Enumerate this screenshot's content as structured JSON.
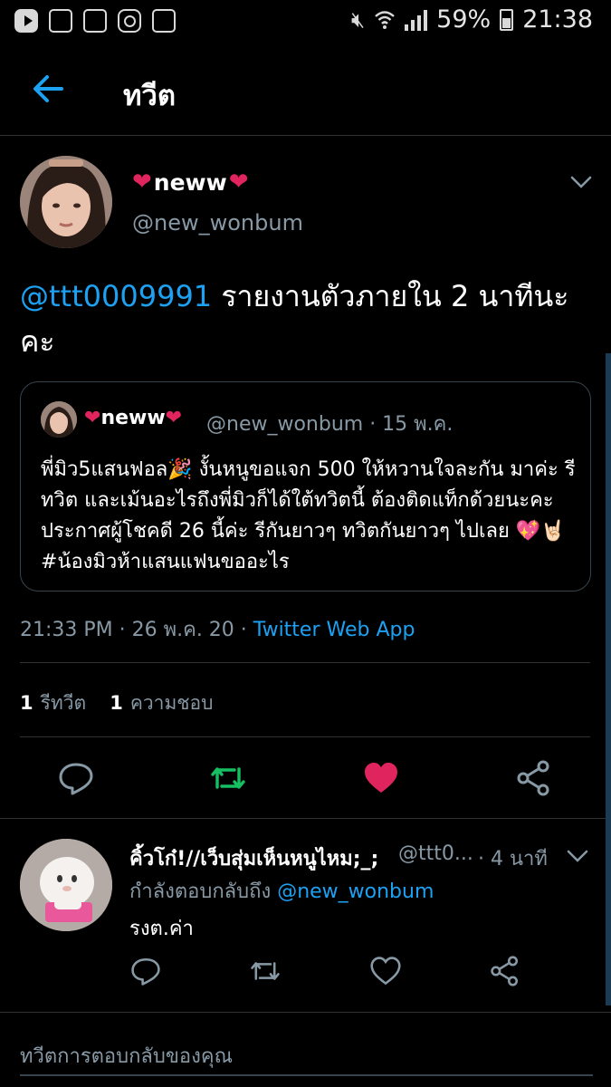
{
  "status_bar": {
    "left_icons": [
      "youtube-icon",
      "gallery-icon",
      "keyboard-icon",
      "instagram-icon",
      "dictionary-icon"
    ],
    "battery": "59%",
    "time": "21:38"
  },
  "header": {
    "title": "ทวีต"
  },
  "tweet": {
    "display_name": "neww",
    "handle": "@new_wonbum",
    "mention": "@ttt0009991",
    "text": " รายงานตัวภายใน 2 นาทีนะคะ",
    "quote": {
      "display_name": "neww",
      "handle_time": "@new_wonbum · 15 พ.ค.",
      "text": "พี่มิว5แสนฟอล🎉 งั้นหนูขอแจก 500 ให้หวานใจละกัน มาค่ะ รีทวิต และเม้นอะไรถึงพี่มิวก็ได้ใต้ทวิตนี้ ต้องติดแท็กด้วยนะคะ ประกาศผู้โชคดี 26 นี้ค่ะ รีกันยาวๆ ทวิตกันยาวๆ ไปเลย 💖🤘🏻 #น้องมิวห้าแสนแฟนขออะไร"
    },
    "timestamp": "21:33 PM · 26 พ.ค. 20 · ",
    "source": "Twitter Web App",
    "retweets_count": "1",
    "retweets_label": "รีทวีต",
    "likes_count": "1",
    "likes_label": "ความชอบ",
    "liked": true,
    "retweeted": true
  },
  "reply": {
    "display_name": "คิ้วโก๋!//เว็บสุ่มเห็นหนูไหม;_;",
    "handle": "@ttt0...",
    "time": "· 4 นาที",
    "replying_label": "กำลังตอบกลับถึง ",
    "replying_to": "@new_wonbum",
    "text": "รงต.ค่า"
  },
  "compose": {
    "placeholder": "ทวีตการตอบกลับของคุณ"
  },
  "colors": {
    "accent": "#1da1f2",
    "like": "#e0245e",
    "retweet": "#17bf63",
    "muted": "#8899a6"
  }
}
